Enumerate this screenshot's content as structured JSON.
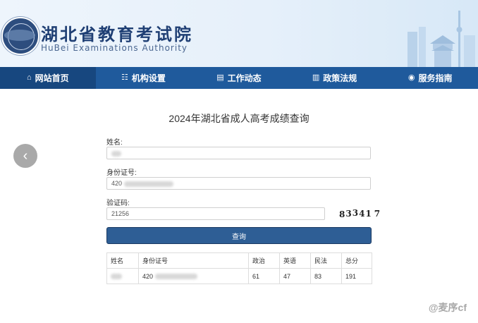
{
  "header": {
    "title_cn": "湖北省教育考试院",
    "title_en": "HuBei Examinations Authority"
  },
  "nav": [
    {
      "label": "网站首页",
      "icon": "home-icon"
    },
    {
      "label": "机构设置",
      "icon": "org-chart-icon"
    },
    {
      "label": "工作动态",
      "icon": "document-icon"
    },
    {
      "label": "政策法规",
      "icon": "book-icon"
    },
    {
      "label": "服务指南",
      "icon": "compass-icon"
    }
  ],
  "page_title": "2024年湖北省成人高考成绩查询",
  "form": {
    "name_label": "姓名:",
    "name_value": "",
    "id_label": "身份证号:",
    "id_value": "420",
    "captcha_label": "验证码:",
    "captcha_value": "21256",
    "captcha_image_text": [
      "8",
      "3",
      "3",
      "4",
      "1",
      "7"
    ],
    "submit_label": "查询"
  },
  "results": {
    "headers": [
      "姓名",
      "身份证号",
      "政治",
      "英语",
      "民法",
      "总分"
    ],
    "rows": [
      [
        "",
        "420",
        "61",
        "47",
        "83",
        "191"
      ]
    ]
  },
  "watermark": "@麦序cf",
  "colors": {
    "nav_bg": "#1f5a9c",
    "nav_active": "#17477f",
    "button_bg": "#2e5e95"
  }
}
